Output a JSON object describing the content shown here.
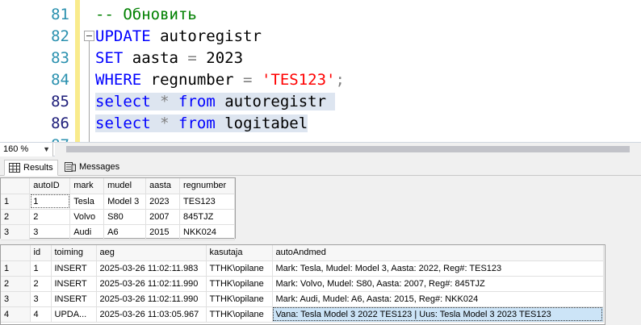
{
  "editor": {
    "lines": [
      {
        "num": "81",
        "tokens": [
          {
            "t": "-- Обновить",
            "c": "cm"
          }
        ],
        "selected": false
      },
      {
        "num": "82",
        "tokens": [
          {
            "t": "UPDATE",
            "c": "kw"
          },
          {
            "t": " autoregistr",
            "c": ""
          }
        ],
        "selected": false
      },
      {
        "num": "83",
        "tokens": [
          {
            "t": "SET",
            "c": "kw"
          },
          {
            "t": " aasta ",
            "c": ""
          },
          {
            "t": "=",
            "c": "op"
          },
          {
            "t": " 2023",
            "c": ""
          }
        ],
        "selected": false
      },
      {
        "num": "84",
        "tokens": [
          {
            "t": "WHERE",
            "c": "kw"
          },
          {
            "t": " regnumber ",
            "c": ""
          },
          {
            "t": "=",
            "c": "op"
          },
          {
            "t": " ",
            "c": ""
          },
          {
            "t": "'TES123'",
            "c": "str"
          },
          {
            "t": ";",
            "c": "pun"
          }
        ],
        "selected": false
      },
      {
        "num": "85",
        "tokens": [
          {
            "t": "select",
            "c": "kw"
          },
          {
            "t": " ",
            "c": ""
          },
          {
            "t": "*",
            "c": "op"
          },
          {
            "t": " ",
            "c": ""
          },
          {
            "t": "from",
            "c": "kw"
          },
          {
            "t": " autoregistr ",
            "c": ""
          }
        ],
        "selected": true
      },
      {
        "num": "86",
        "tokens": [
          {
            "t": "select",
            "c": "kw"
          },
          {
            "t": " ",
            "c": ""
          },
          {
            "t": "*",
            "c": "op"
          },
          {
            "t": " ",
            "c": ""
          },
          {
            "t": "from",
            "c": "kw"
          },
          {
            "t": " logitabel",
            "c": ""
          }
        ],
        "selected": true
      },
      {
        "num": "87",
        "tokens": [],
        "selected": false
      }
    ]
  },
  "zoom": {
    "value": "160 %"
  },
  "tabs": {
    "results": "Results",
    "messages": "Messages"
  },
  "grid1": {
    "columns": [
      "autoID",
      "mark",
      "mudel",
      "aasta",
      "regnumber"
    ],
    "rows": [
      {
        "rn": "1",
        "cells": [
          "1",
          "Tesla",
          "Model 3",
          "2023",
          "TES123"
        ]
      },
      {
        "rn": "2",
        "cells": [
          "2",
          "Volvo",
          "S80",
          "2007",
          "845TJZ"
        ]
      },
      {
        "rn": "3",
        "cells": [
          "3",
          "Audi",
          "A6",
          "2015",
          "NKK024"
        ]
      }
    ]
  },
  "grid2": {
    "columns": [
      "id",
      "toiming",
      "aeg",
      "kasutaja",
      "autoAndmed"
    ],
    "rows": [
      {
        "rn": "1",
        "cells": [
          "1",
          "INSERT",
          "2025-03-26 11:02:11.983",
          "TTHK\\opilane",
          "Mark: Tesla, Mudel: Model 3, Aasta: 2022, Reg#: TES123"
        ]
      },
      {
        "rn": "2",
        "cells": [
          "2",
          "INSERT",
          "2025-03-26 11:02:11.990",
          "TTHK\\opilane",
          "Mark: Volvo, Mudel: S80, Aasta: 2007, Reg#: 845TJZ"
        ]
      },
      {
        "rn": "3",
        "cells": [
          "3",
          "INSERT",
          "2025-03-26 11:02:11.990",
          "TTHK\\opilane",
          "Mark: Audi, Mudel: A6, Aasta: 2015, Reg#: NKK024"
        ]
      },
      {
        "rn": "4",
        "cells": [
          "4",
          "UPDA...",
          "2025-03-26 11:03:05.967",
          "TTHK\\opilane",
          "Vana: Tesla Model 3 2022 TES123 | Uus: Tesla Model 3 2023 TES123"
        ]
      }
    ]
  }
}
